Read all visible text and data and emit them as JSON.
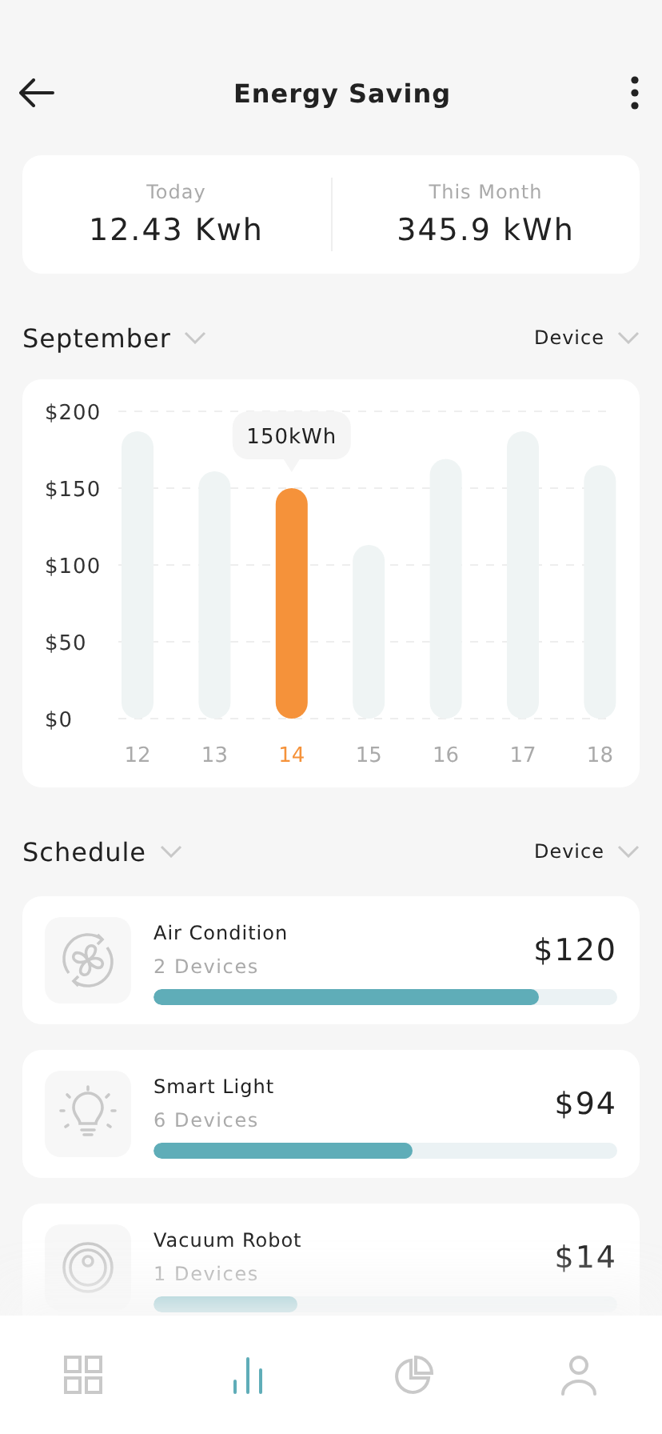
{
  "header": {
    "title": "Energy Saving"
  },
  "summary": [
    {
      "label": "Today",
      "value": "12.43 Kwh"
    },
    {
      "label": "This Month",
      "value": "345.9 kWh"
    }
  ],
  "usage": {
    "period": "September",
    "filter": "Device",
    "tooltip": "150kWh",
    "selected_category": "14",
    "chart_data": {
      "type": "bar",
      "grid": true,
      "categories": [
        "12",
        "13",
        "14",
        "15",
        "16",
        "17",
        "18"
      ],
      "values": [
        187,
        161,
        150,
        113,
        169,
        187,
        165
      ],
      "ylim": [
        0,
        200
      ],
      "yticks": [
        {
          "value": 0,
          "label": "$0"
        },
        {
          "value": 50,
          "label": "$50"
        },
        {
          "value": 100,
          "label": "$100"
        },
        {
          "value": 150,
          "label": "$150"
        },
        {
          "value": 200,
          "label": "$200"
        }
      ]
    }
  },
  "schedule": {
    "title": "Schedule",
    "filter": "Device",
    "items": [
      {
        "kind": "fan",
        "name": "Air Condition",
        "devices": "2 Devices",
        "cost": "$120",
        "level": 0.83
      },
      {
        "kind": "bulb",
        "name": "Smart Light",
        "devices": "6 Devices",
        "cost": "$94",
        "level": 0.56
      },
      {
        "kind": "vacuum",
        "name": "Vacuum Robot",
        "devices": "1 Devices",
        "cost": "$14",
        "level": 0.31
      }
    ]
  },
  "nav": [
    {
      "kind": "grid",
      "selected": false
    },
    {
      "kind": "bars",
      "selected": true
    },
    {
      "kind": "pie",
      "selected": false
    },
    {
      "kind": "person",
      "selected": false
    }
  ]
}
